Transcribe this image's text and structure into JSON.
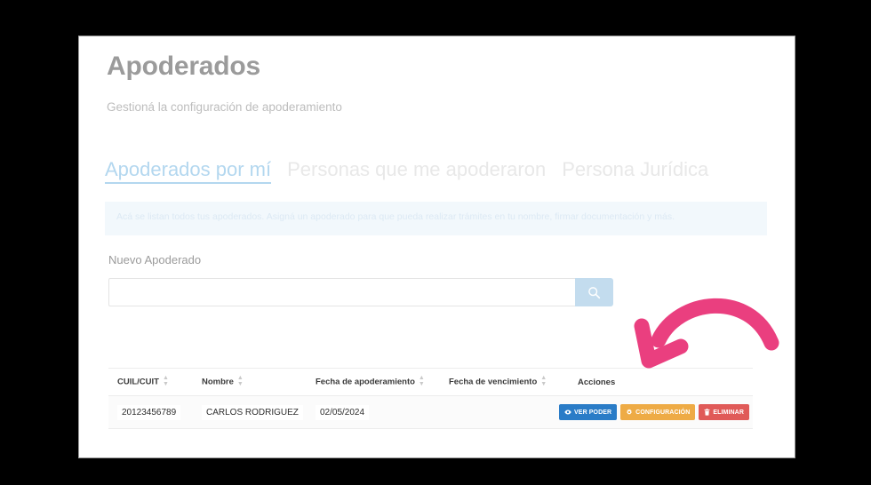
{
  "page": {
    "title": "Apoderados",
    "subtitle": "Gestioná la configuración de apoderamiento"
  },
  "tabs": [
    {
      "label": "Apoderados por mí",
      "active": true
    },
    {
      "label": "Personas que me apoderaron",
      "active": false
    },
    {
      "label": "Persona Jurídica",
      "active": false
    }
  ],
  "info_banner": {
    "text": "Acá se listan todos tus apoderados. Asigná un apoderado para que pueda realizar trámites en tu nombre, firmar documentación y más."
  },
  "search": {
    "label": "Nuevo Apoderado",
    "value": "",
    "placeholder": "",
    "button_icon": "search-icon"
  },
  "table": {
    "columns": [
      {
        "label": "CUIL/CUIT",
        "sortable": true
      },
      {
        "label": "Nombre",
        "sortable": true
      },
      {
        "label": "Fecha de apoderamiento",
        "sortable": true
      },
      {
        "label": "Fecha de vencimiento",
        "sortable": true
      },
      {
        "label": "Acciones",
        "sortable": false
      }
    ],
    "rows": [
      {
        "cuil": "20123456789",
        "nombre": "CARLOS RODRIGUEZ",
        "fecha_apoderamiento": "02/05/2024",
        "fecha_vencimiento": "",
        "actions": [
          {
            "label": "VER PODER",
            "icon": "eye-icon",
            "color": "#2a7cc7"
          },
          {
            "label": "CONFIGURACIÓN",
            "icon": "gear-icon",
            "color": "#eeab45"
          },
          {
            "label": "ELIMINAR",
            "icon": "trash-icon",
            "color": "#e05a58"
          }
        ]
      }
    ]
  },
  "annotation": {
    "type": "curved-arrow",
    "color": "#ea3f7f",
    "points_to": "row-action-buttons"
  },
  "colors": {
    "accent_tab": "#b3d7ef",
    "banner_bg": "#f2f8fc",
    "search_button": "#c3dcee",
    "annotation": "#ea3f7f",
    "page_bg": "#000000",
    "card_bg": "#ffffff"
  }
}
